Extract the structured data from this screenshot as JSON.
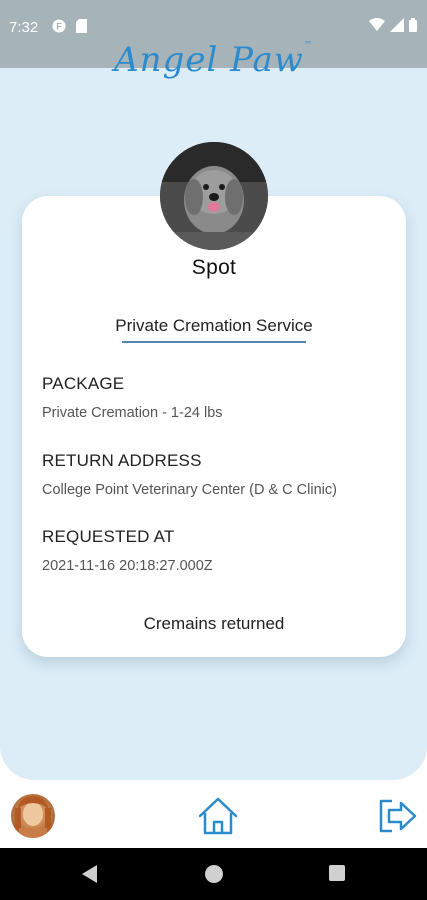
{
  "status_bar": {
    "time": "7:32"
  },
  "app": {
    "logo_text": "Angel Paw",
    "logo_tm": "™"
  },
  "pet": {
    "name": "Spot",
    "service_title": "Private Cremation Service"
  },
  "details": {
    "package_label": "PACKAGE",
    "package_value": "Private Cremation - 1-24 lbs",
    "return_address_label": "RETURN ADDRESS",
    "return_address_value": "College Point Veterinary Center (D & C Clinic)",
    "requested_at_label": "REQUESTED AT",
    "requested_at_value": "2021-11-16 20:18:27.000Z"
  },
  "status": {
    "text": "Cremains returned"
  },
  "colors": {
    "accent": "#2c8bcc",
    "background": "#dcedf8",
    "status_bar": "#a6b4ba"
  },
  "icons": {
    "home": "home-icon",
    "logout": "logout-icon"
  }
}
